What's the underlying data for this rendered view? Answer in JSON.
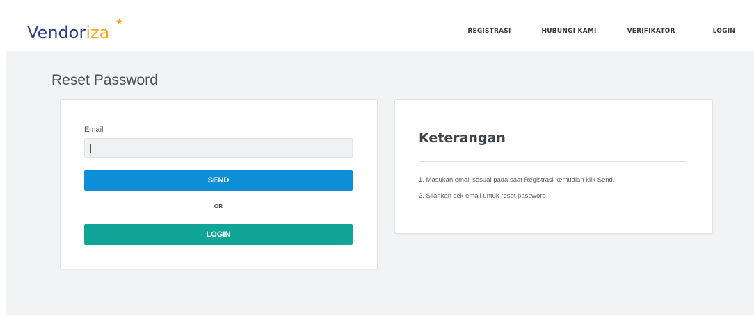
{
  "header": {
    "logo": {
      "part1": "Vendor",
      "part2": "iza",
      "star": "★"
    },
    "nav": [
      {
        "label": "REGISTRASI"
      },
      {
        "label": "HUBUNGI KAMI"
      },
      {
        "label": "VERIFIKATOR"
      },
      {
        "label": "LOGIN"
      }
    ]
  },
  "page": {
    "title": "Reset Password"
  },
  "form": {
    "email_label": "Email",
    "email_value": "",
    "send_label": "SEND",
    "or_label": "OR",
    "login_label": "LOGIN"
  },
  "info": {
    "title": "Keterangan",
    "items": [
      "1. Masukan email sesuai pada saat Registrasi kemudian klik Send.",
      "2. Silahkan cek email untuk reset password."
    ]
  },
  "colors": {
    "send_button": "#0f8ed8",
    "login_button": "#10a596",
    "logo_dark": "#2e3a8c",
    "logo_orange": "#f5a623"
  }
}
